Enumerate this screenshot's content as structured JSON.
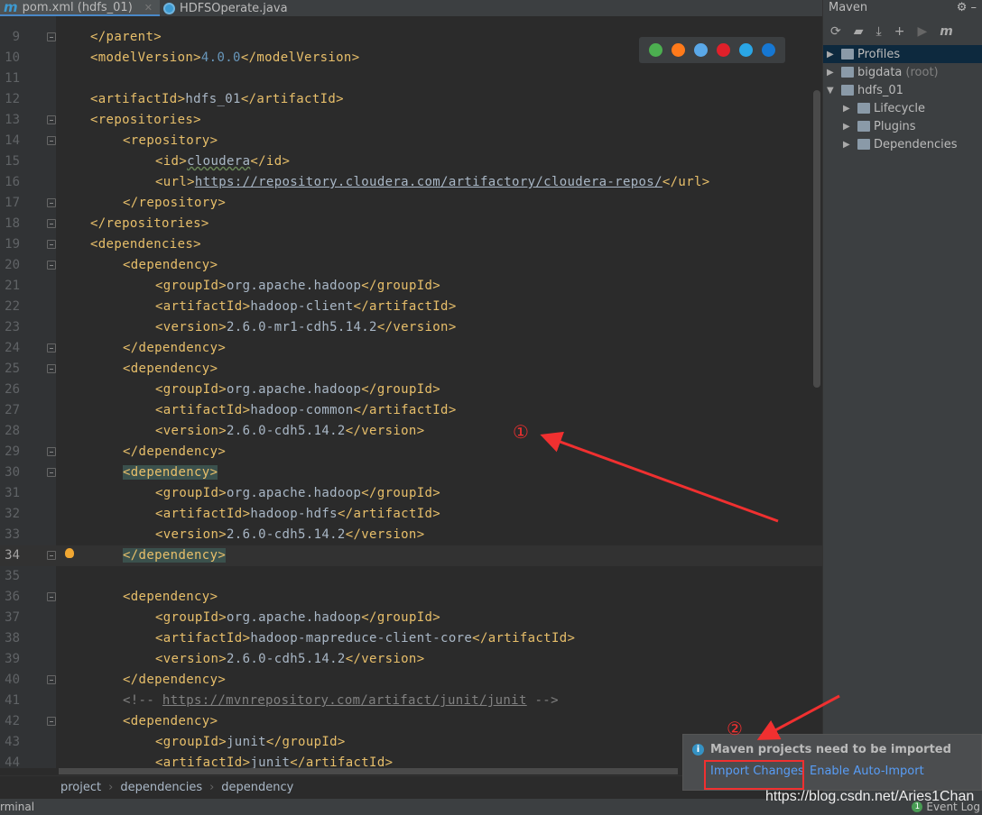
{
  "tabs": [
    {
      "label": "pom.xml (hdfs_01)",
      "icon": "maven-m-icon",
      "active": true
    },
    {
      "label": "HDFSOperate.java",
      "icon": "java-class-icon",
      "active": false
    }
  ],
  "editor": {
    "current_line": 34,
    "lines": [
      {
        "n": 9,
        "i": 0,
        "t": "</parent>",
        "fold": true
      },
      {
        "n": 10,
        "i": 0,
        "t": "<modelVersion>4.0.0</modelVersion>"
      },
      {
        "n": 11,
        "i": 0,
        "t": ""
      },
      {
        "n": 12,
        "i": 0,
        "t": "<artifactId>hdfs_01</artifactId>"
      },
      {
        "n": 13,
        "i": 0,
        "t": "<repositories>",
        "fold": true
      },
      {
        "n": 14,
        "i": 1,
        "t": "<repository>",
        "fold": true
      },
      {
        "n": 15,
        "i": 2,
        "t": "<id>cloudera</id>"
      },
      {
        "n": 16,
        "i": 2,
        "t": "<url>https://repository.cloudera.com/artifactory/cloudera-repos/</url>"
      },
      {
        "n": 17,
        "i": 1,
        "t": "</repository>",
        "fold": true
      },
      {
        "n": 18,
        "i": 0,
        "t": "</repositories>",
        "fold": true
      },
      {
        "n": 19,
        "i": 0,
        "t": "<dependencies>",
        "fold": true
      },
      {
        "n": 20,
        "i": 1,
        "t": "<dependency>",
        "fold": true
      },
      {
        "n": 21,
        "i": 2,
        "t": "<groupId>org.apache.hadoop</groupId>"
      },
      {
        "n": 22,
        "i": 2,
        "t": "<artifactId>hadoop-client</artifactId>"
      },
      {
        "n": 23,
        "i": 2,
        "t": "<version>2.6.0-mr1-cdh5.14.2</version>"
      },
      {
        "n": 24,
        "i": 1,
        "t": "</dependency>",
        "fold": true
      },
      {
        "n": 25,
        "i": 1,
        "t": "<dependency>",
        "fold": true
      },
      {
        "n": 26,
        "i": 2,
        "t": "<groupId>org.apache.hadoop</groupId>"
      },
      {
        "n": 27,
        "i": 2,
        "t": "<artifactId>hadoop-common</artifactId>"
      },
      {
        "n": 28,
        "i": 2,
        "t": "<version>2.6.0-cdh5.14.2</version>"
      },
      {
        "n": 29,
        "i": 1,
        "t": "</dependency>",
        "fold": true
      },
      {
        "n": 30,
        "i": 1,
        "t": "<dependency>",
        "fold": true,
        "hl": true
      },
      {
        "n": 31,
        "i": 2,
        "t": "<groupId>org.apache.hadoop</groupId>"
      },
      {
        "n": 32,
        "i": 2,
        "t": "<artifactId>hadoop-hdfs</artifactId>"
      },
      {
        "n": 33,
        "i": 2,
        "t": "<version>2.6.0-cdh5.14.2</version>"
      },
      {
        "n": 34,
        "i": 1,
        "t": "</dependency>",
        "fold": true,
        "hl": true,
        "bulb": true
      },
      {
        "n": 35,
        "i": 0,
        "t": ""
      },
      {
        "n": 36,
        "i": 1,
        "t": "<dependency>",
        "fold": true
      },
      {
        "n": 37,
        "i": 2,
        "t": "<groupId>org.apache.hadoop</groupId>"
      },
      {
        "n": 38,
        "i": 2,
        "t": "<artifactId>hadoop-mapreduce-client-core</artifactId>"
      },
      {
        "n": 39,
        "i": 2,
        "t": "<version>2.6.0-cdh5.14.2</version>"
      },
      {
        "n": 40,
        "i": 1,
        "t": "</dependency>",
        "fold": true
      },
      {
        "n": 41,
        "i": 1,
        "t": "<!-- https://mvnrepository.com/artifact/junit/junit -->",
        "comment": true
      },
      {
        "n": 42,
        "i": 1,
        "t": "<dependency>",
        "fold": true
      },
      {
        "n": 43,
        "i": 2,
        "t": "<groupId>junit</groupId>"
      },
      {
        "n": 44,
        "i": 2,
        "t": "<artifactId>junit</artifactId>"
      }
    ]
  },
  "browsers": [
    {
      "name": "chrome-icon",
      "color": "#4caf50"
    },
    {
      "name": "firefox-icon",
      "color": "#ff7a1a"
    },
    {
      "name": "safari-icon",
      "color": "#5aa8e8"
    },
    {
      "name": "opera-icon",
      "color": "#e0202a"
    },
    {
      "name": "ie-icon",
      "color": "#2aa6e6"
    },
    {
      "name": "edge-icon",
      "color": "#1677d2"
    }
  ],
  "breadcrumb": [
    "project",
    "dependencies",
    "dependency"
  ],
  "maven": {
    "title": "Maven",
    "tree": [
      {
        "label": "Profiles",
        "depth": 0,
        "open": false,
        "sel": true
      },
      {
        "label": "bigdata",
        "suffix": "(root)",
        "depth": 0,
        "open": false
      },
      {
        "label": "hdfs_01",
        "depth": 0,
        "open": true
      },
      {
        "label": "Lifecycle",
        "depth": 1,
        "open": false
      },
      {
        "label": "Plugins",
        "depth": 1,
        "open": false
      },
      {
        "label": "Dependencies",
        "depth": 1,
        "open": false
      }
    ]
  },
  "notification": {
    "title": "Maven projects need to be imported",
    "import_label": "Import Changes",
    "auto_label": "Enable Auto-Import"
  },
  "status": {
    "left": "rminal",
    "event_count": "1",
    "event_label": "Event Log"
  },
  "annotations": {
    "mark1": "①",
    "mark2": "②",
    "color": "#f03030"
  },
  "watermark": "https://blog.csdn.net/Aries1Chan"
}
